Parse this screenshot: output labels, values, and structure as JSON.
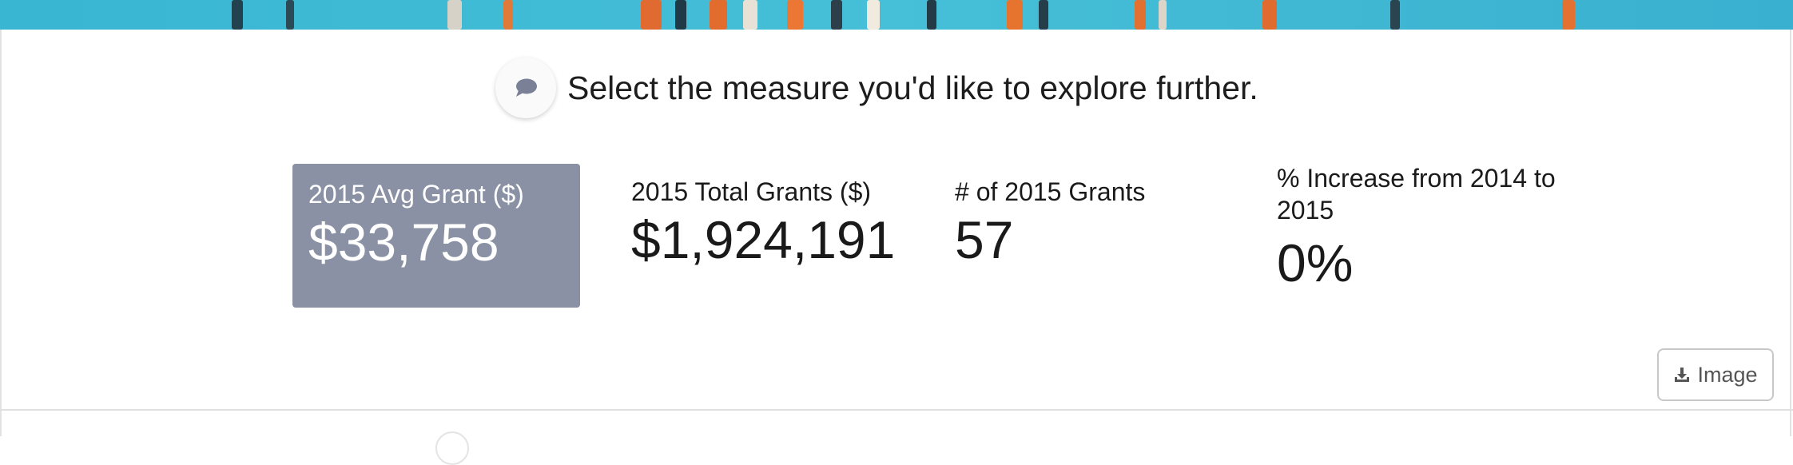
{
  "prompt": {
    "icon": "speech-bubble-icon",
    "text": "Select the measure you'd like to explore further."
  },
  "metrics": [
    {
      "label": "2015 Avg Grant ($)",
      "value": "$33,758",
      "selected": true
    },
    {
      "label": "2015 Total Grants ($)",
      "value": "$1,924,191",
      "selected": false
    },
    {
      "label": "# of 2015 Grants",
      "value": "57",
      "selected": false
    },
    {
      "label": "% Increase from 2014 to 2015",
      "value": "0%",
      "selected": false
    }
  ],
  "image_button": {
    "icon": "download-icon",
    "label": "Image"
  },
  "colors": {
    "banner": "#46bfd8",
    "selected_tile": "#8a91a4",
    "text": "#1a1a1a"
  }
}
